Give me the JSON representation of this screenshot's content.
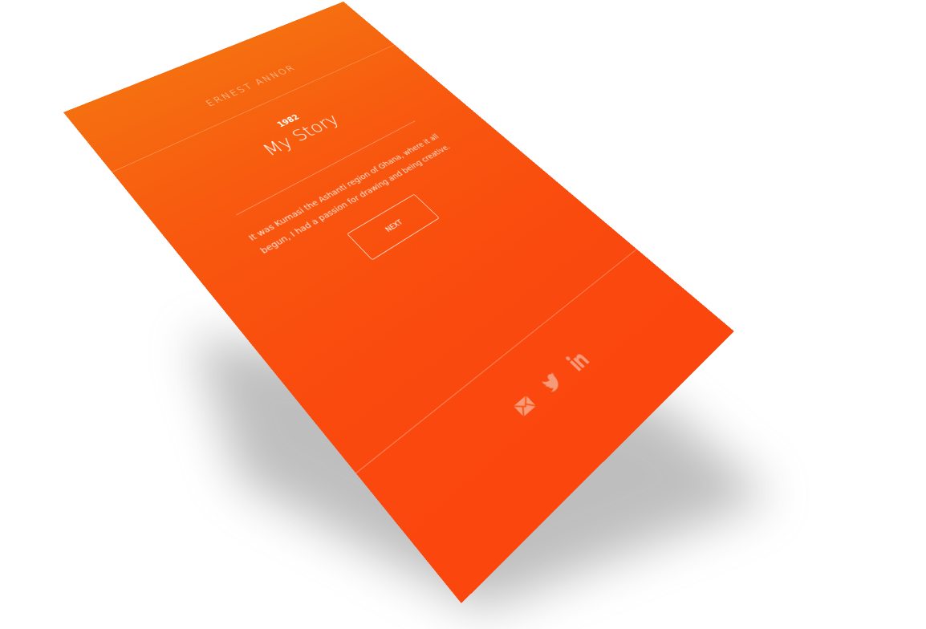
{
  "header": {
    "brand": "ERNEST ANNOR"
  },
  "story": {
    "year": "1982",
    "title": "My Story",
    "body": "It was Kumasi the Ashanti region of Ghana, where it all begun, I had a passion for drawing and being creative."
  },
  "actions": {
    "next_label": "NEXT"
  },
  "footer": {
    "social": [
      {
        "icon": "mail-icon"
      },
      {
        "icon": "twitter-icon"
      },
      {
        "icon": "linkedin-icon"
      }
    ]
  },
  "colors": {
    "gradient_top": "#f56f10",
    "gradient_bottom": "#fb460e",
    "text": "#ffffff",
    "icons": "#f69a7a",
    "background": "#ffffff"
  }
}
